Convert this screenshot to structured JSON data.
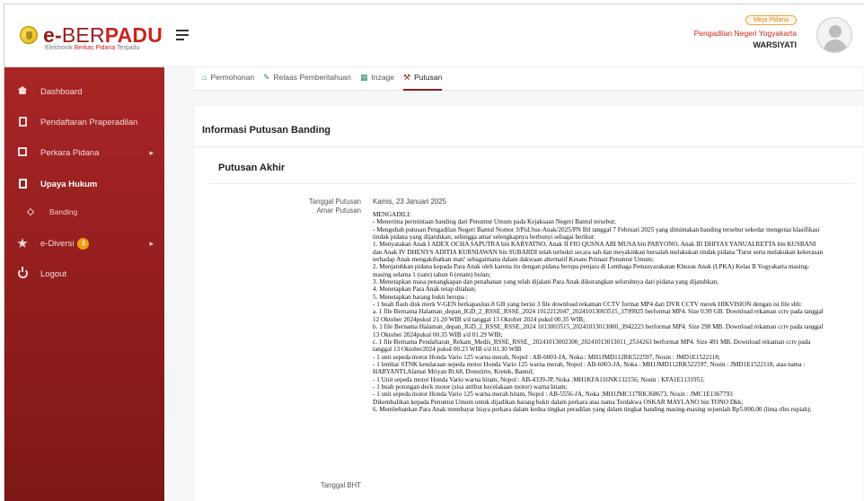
{
  "header": {
    "logo_e": "e-",
    "logo_ber": "BER",
    "logo_padu": "PADU",
    "logo_sub_1": "Elektronik",
    "logo_sub_2": "Berkas Pidana",
    "logo_sub_3": "Terpadu",
    "meja_badge": "Meja Pidana",
    "court_name": "Pengadilan Negeri Yogyakarta",
    "user_name": "WARSIYATI"
  },
  "sidebar": {
    "items": [
      {
        "label": "Dashboard",
        "icon": "home-icon"
      },
      {
        "label": "Pendaftaran Praperadilan",
        "icon": "file-icon"
      },
      {
        "label": "Perkara Pidana",
        "icon": "edit-icon"
      },
      {
        "label": "Upaya Hukum",
        "icon": "file-icon"
      },
      {
        "label": "Banding",
        "icon": "diamond-icon"
      },
      {
        "label": "e-Diversi",
        "icon": "star-icon",
        "badge": "3"
      },
      {
        "label": "Logout",
        "icon": "power-icon"
      }
    ]
  },
  "tabs": [
    {
      "label": "Permohonan",
      "icon": "home-icon"
    },
    {
      "label": "Relaas Pemberitahuan",
      "icon": "pencil-icon"
    },
    {
      "label": "Inzage",
      "icon": "calendar-icon"
    },
    {
      "label": "Putusan",
      "icon": "gavel-icon"
    }
  ],
  "content": {
    "card_title": "Informasi Putusan Banding",
    "section_title": "Putusan Akhir",
    "label_tanggal_putusan": "Tanggal Putusan",
    "value_tanggal_putusan": "Kamis, 23 Januari 2025",
    "label_amar_putusan": "Amar Putusan",
    "label_tanggal_bht": "Tanggal BHT",
    "amar_lines": [
      "MENGADILI:",
      "- Menerima permintaan banding dari Penuntut Umum pada Kejaksaan Negeri Bantul tersebut;",
      "- Mengubah putusan Pengadilan Negeri Bantul Nomor 3/Pid.Sus-Anak/2025/PN Btl tanggal 7 Februari 2025 yang dimintakan banding tersebut sekedar mengenai klasifikasi tindak pidana yang dijatuhkan, sehingga amar selengkapnya berbunyi sebagai berikut:",
      "1. Menyatakan Anak I ADEX OCHA SAPUTRA bin KARYATNO, Anak II FIO QUSNA ABI MUSA bin PARYONO, Anak III DHIYAS YANUALRETTA bin KUSBANI dan Anak IV DHENYS ADITIA KURNIAWAN bin SUBARDI telah terbukti secara sah dan meyakinkan bersalah melakukan tindak pidana 'Turut serta melakukan kekerasan terhadap Anak mengakibatkan mati' sebagaimana dalam dakwaan alternatif Kesatu Primair Penuntut Umum;",
      "2. Menjatuhkan pidana kepada Para Anak oleh karena itu dengan pidana berupa penjara di Lembaga Pemasyarakatan Khusus Anak (LPKA) Kelas II Yogyakarta masing-masing selama 1 (satu) tahun 6 (enam) bulan;",
      "3. Menetapkan masa penangkapan dan penahanan yang telah dijalani Para Anak dikurangkan seluruhnya dari pidana yang dijatuhkan;",
      "4. Menetapkan Para Anak tetap ditahan;",
      "5. Menetapkan barang bukti berupa :",
      "- 1 buah flash disk merk V-GEN berkapasitas 8 GB yang berisi 3 file download rekaman CCTV format MP4 dari DVR CCTV merek HIKVISION dengan isi file sbb:",
      "a. 1 file Bernama Halaman_depan_IGD_2_RSSE_RSSE_2024 1012212047_20241013003515_3799925 berformat MP4. Size 0.99 GB. Download rekaman cctv pada tanggal 12 Oktober 2024pukul 21.20 WIB s/d tanggal 13 Oktober 2024 pukul 00.35 WIB;",
      "b. 1 file Bernama Halaman_depan_IGD_2_RSSE_RSSE_2024 1013003515_20241013013000_3942223 berformat MP4. Size 298 MB. Download rekaman cctv pada tanggal 13 Oktober 2024pukul 00.35 WIB s/d 01.29 WIB;",
      "c. 1 file Bernama Pendaftaran_Rekam_Medis_RSSE_RSSE_ 20241013002300_20241013013011_2534263 berformat MP4. Size 491 MB. Download rekaman cctv pada tanggal 13 Oktober2024 pukul 00.23 WIB s/d 01.30 WIB",
      "- 1 unit sepeda motor Honda Vario 125 warna merah, Nopol : AB-6003-JA, Noka : MH1JMD112RK522597, Nosin : JMD1E1522118;",
      "- 1 lembar STNK kendaraan sepeda motor Honda Vario 125 warna merah, Nopol : AB-6003-JA, Noka : MH1JMD112RK522597, Nosin : JMD1E1522118, atas nama : HARYANTI,Alamat Mriyan Rt.68, Donotirto, Kretek, Bantul;",
      "- 1 Unit sepeda motor Honda Vario warna hitam, Nopol : AB-4339-JP, Noka :MH1KFA116NK132156, Nosin : KFA1E1131951;",
      "- 1 buah potongan deck motor (sisa atribut kecelakaan motor) warna hitam;",
      "- 1 unit sepeda motor Honda Vario 125 warna merah hitam, Nopol : AB-5556-JA, Noka :MH1JMC117RK368673, Nosin : JMC1E1367793",
      "Dikembalikan kepada Penuntut Umum untuk dijadikan barang bukti dalam perkara atas nama Terdakwa OSKAR MAYLANO bin TONO Dkk;",
      "6. Membebankan Para Anak membayar biaya perkara dalam kedua tingkat peradilan yang dalam tingkat banding masing-masing sejumlah Rp5.000,00 (lima ribu rupiah);"
    ]
  },
  "colors": {
    "sidebar_top": "#a82525",
    "sidebar_bottom": "#7e1717",
    "brand_red": "#c9251f",
    "tab_active_underline": "#8c1d1d",
    "badge_orange": "#f39c12"
  }
}
